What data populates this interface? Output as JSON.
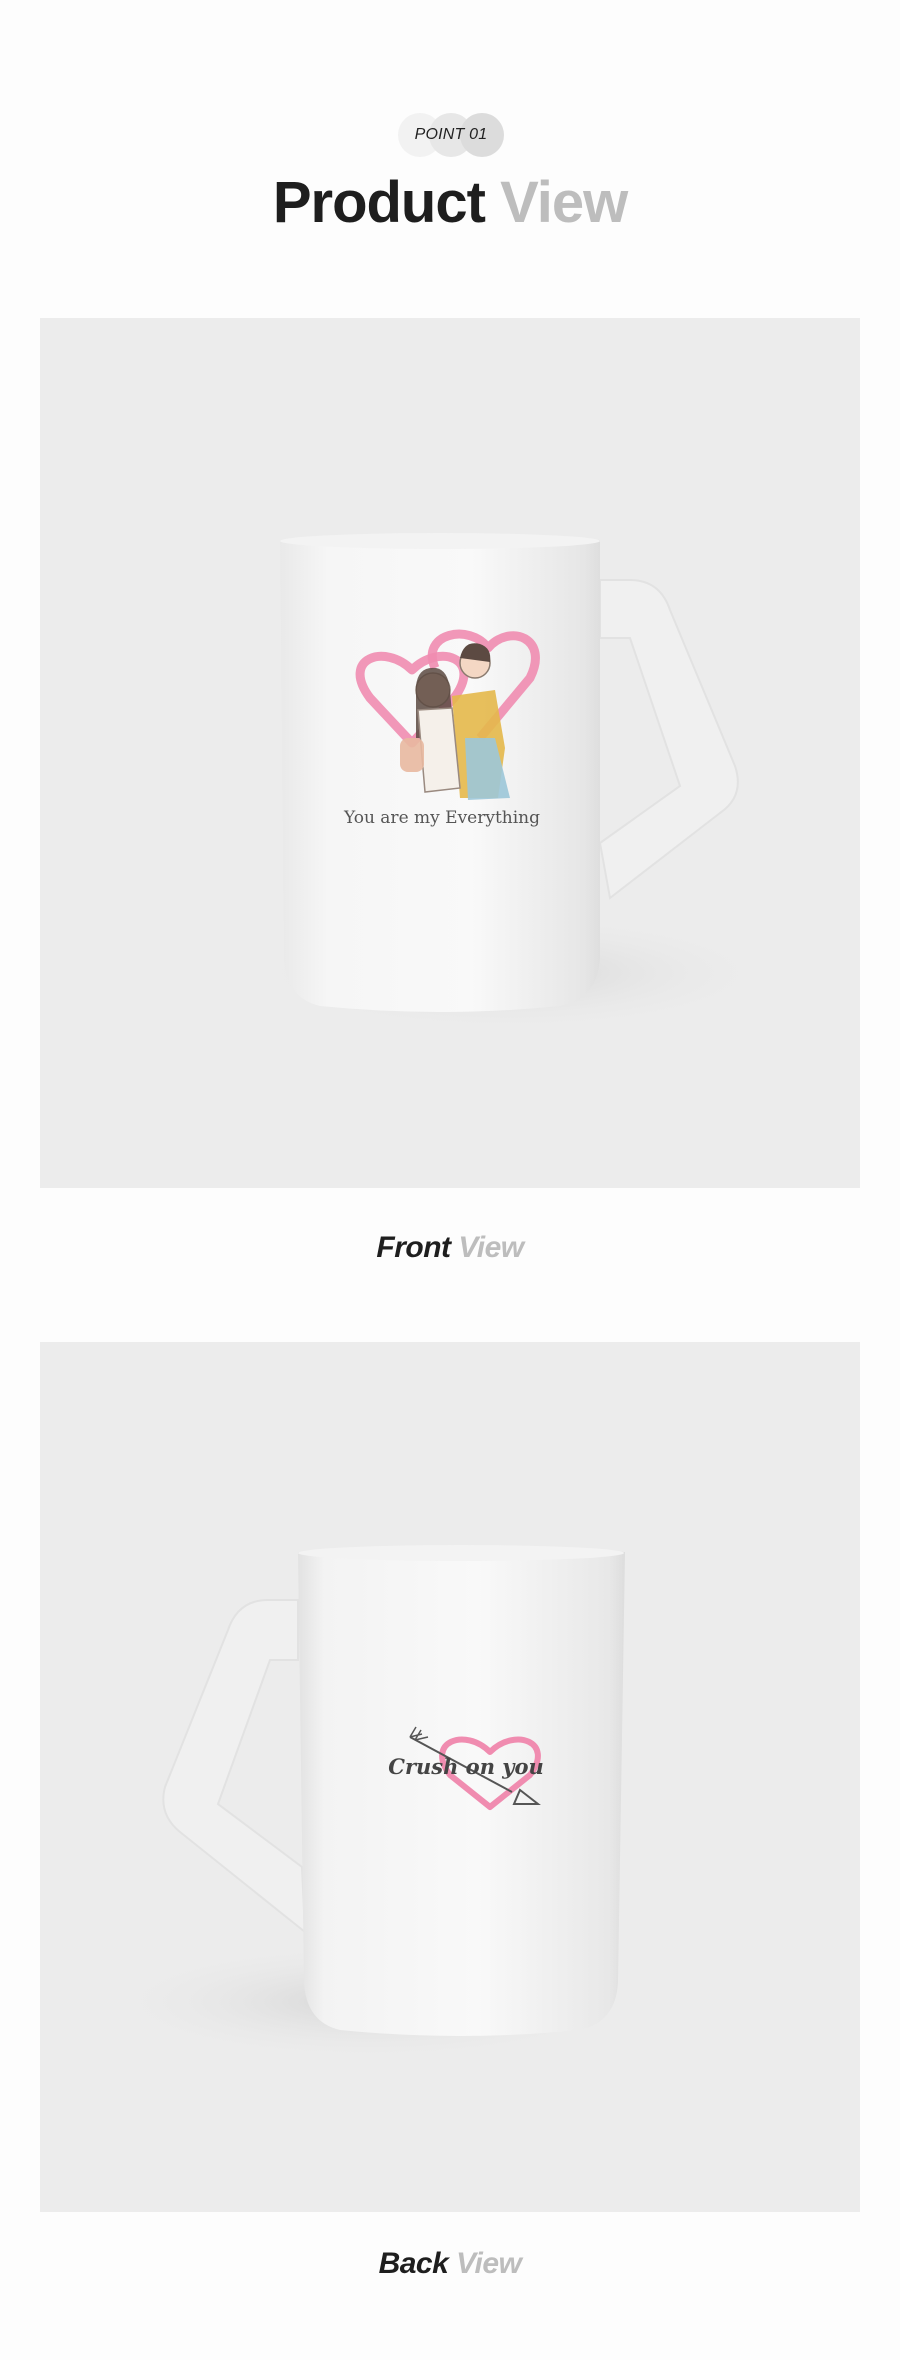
{
  "header": {
    "badge": "POINT 01",
    "title_main": "Product",
    "title_accent": "View"
  },
  "front": {
    "caption_main": "Front",
    "caption_accent": "View",
    "mug_print_text": "You are my Everything"
  },
  "back": {
    "caption_main": "Back",
    "caption_accent": "View",
    "mug_print_text": "Crush on you"
  },
  "colors": {
    "dark_text": "#1e1e1e",
    "accent_text": "#bdbdbd",
    "panel_bg": "#ececec",
    "heart_pink": "#f08cb0"
  }
}
